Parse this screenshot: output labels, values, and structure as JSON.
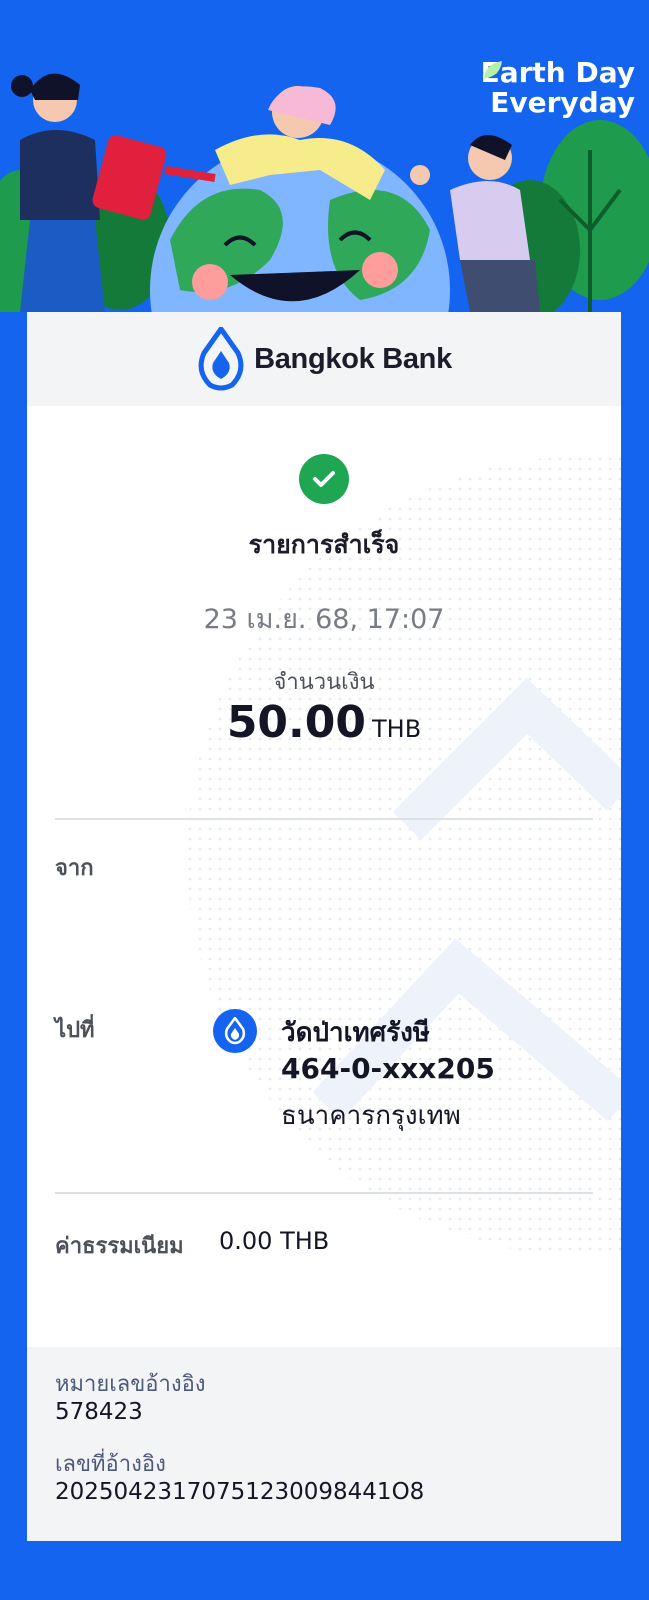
{
  "banner": {
    "title_line1": "Earth Day",
    "title_line2": "Everyday"
  },
  "bank": {
    "name": "Bangkok Bank",
    "brand_color": "#1464f0"
  },
  "transaction": {
    "status": "รายการสำเร็จ",
    "status_icon": "check-circle-icon",
    "datetime": "23 เม.ย. 68, 17:07",
    "amount_label": "จำนวนเงิน",
    "amount": "50.00",
    "currency": "THB"
  },
  "from": {
    "label": "จาก"
  },
  "to": {
    "label": "ไปที่",
    "name": "วัดป่าเทศรังษี",
    "account": "464-0-xxx205",
    "bank": "ธนาคารกรุงเทพ",
    "icon": "bangkok-bank-icon"
  },
  "fee": {
    "label": "ค่าธรรมเนียม",
    "value": "0.00 THB"
  },
  "reference": {
    "ref_no_label": "หมายเลขอ้างอิง",
    "ref_no": "578423",
    "ref_id_label": "เลขที่อ้างอิง",
    "ref_id": "20250423170751230098441O8"
  },
  "colors": {
    "success": "#1fa652",
    "background": "#1464f0"
  }
}
